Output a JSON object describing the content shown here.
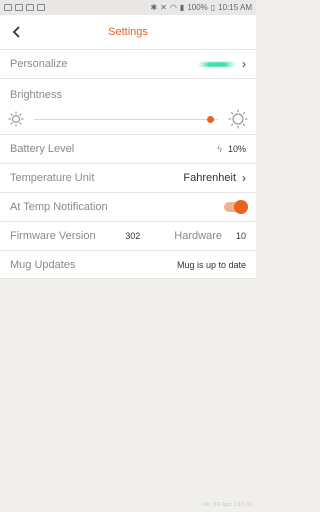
{
  "status": {
    "battery": "100%",
    "time": "10:15 AM"
  },
  "header": {
    "title": "Settings",
    "back_icon": "chevron-left-icon"
  },
  "rows": {
    "personalize": {
      "label": "Personalize",
      "swatch_color": "#3fe0b0"
    },
    "brightness": {
      "label": "Brightness",
      "level": 0.96
    },
    "battery": {
      "label": "Battery Level",
      "value": "10%"
    },
    "temp_unit": {
      "label": "Temperature Unit",
      "value": "Fahrenheit"
    },
    "at_temp": {
      "label": "At Temp Notification",
      "enabled": true
    },
    "firmware": {
      "label": "Firmware Version",
      "value": "302",
      "hw_label": "Hardware",
      "hw_value": "10"
    },
    "mug_updates": {
      "label": "Mug Updates",
      "value": "Mug is up to date"
    }
  },
  "footer": {
    "text": "FW: 302 App: 1.0.0 (3)"
  },
  "colors": {
    "accent": "#e8641e",
    "background": "#f1efec"
  }
}
